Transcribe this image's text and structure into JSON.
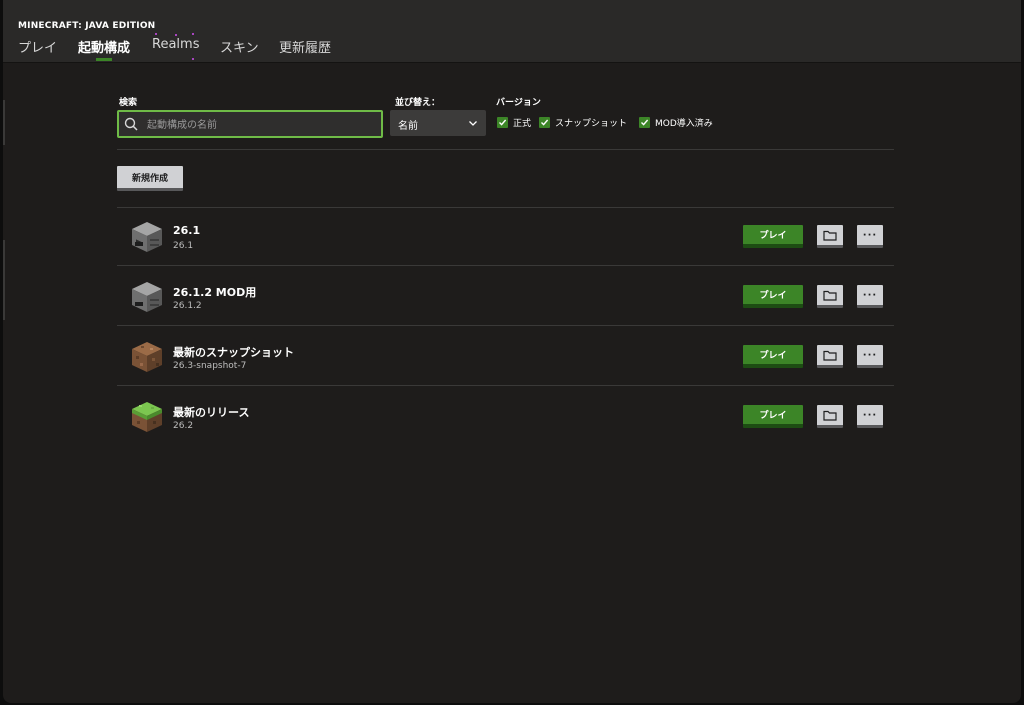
{
  "app": {
    "title": "MINECRAFT: JAVA EDITION"
  },
  "tabs": [
    {
      "label": "プレイ",
      "active": false
    },
    {
      "label": "起動構成",
      "active": true
    },
    {
      "label": "Realms",
      "active": false
    },
    {
      "label": "スキン",
      "active": false
    },
    {
      "label": "更新履歴",
      "active": false
    }
  ],
  "filters": {
    "search_label": "検索",
    "search_placeholder": "起動構成の名前",
    "search_value": "",
    "sort_label": "並び替え：",
    "sort_value": "名前",
    "version_label": "バージョン",
    "versions": [
      {
        "label": "正式",
        "checked": true
      },
      {
        "label": "スナップショット",
        "checked": true
      },
      {
        "label": "MOD導入済み",
        "checked": true
      }
    ]
  },
  "new_button_label": "新規作成",
  "profiles": [
    {
      "name": "26.1",
      "version": "26.1",
      "icon": "furnace-icon"
    },
    {
      "name": "26.1.2 MOD用",
      "version": "26.1.2",
      "icon": "furnace-icon"
    },
    {
      "name": "最新のスナップショット",
      "version": "26.3-snapshot-7",
      "icon": "dirt-block-icon"
    },
    {
      "name": "最新のリリース",
      "version": "26.2",
      "icon": "grass-block-icon"
    }
  ],
  "row_actions": {
    "play_label": "プレイ",
    "more_label": "···"
  },
  "colors": {
    "accent": "#3c8527",
    "focus": "#6fbb47",
    "background": "#1e1c1b",
    "header": "#2a2928"
  }
}
